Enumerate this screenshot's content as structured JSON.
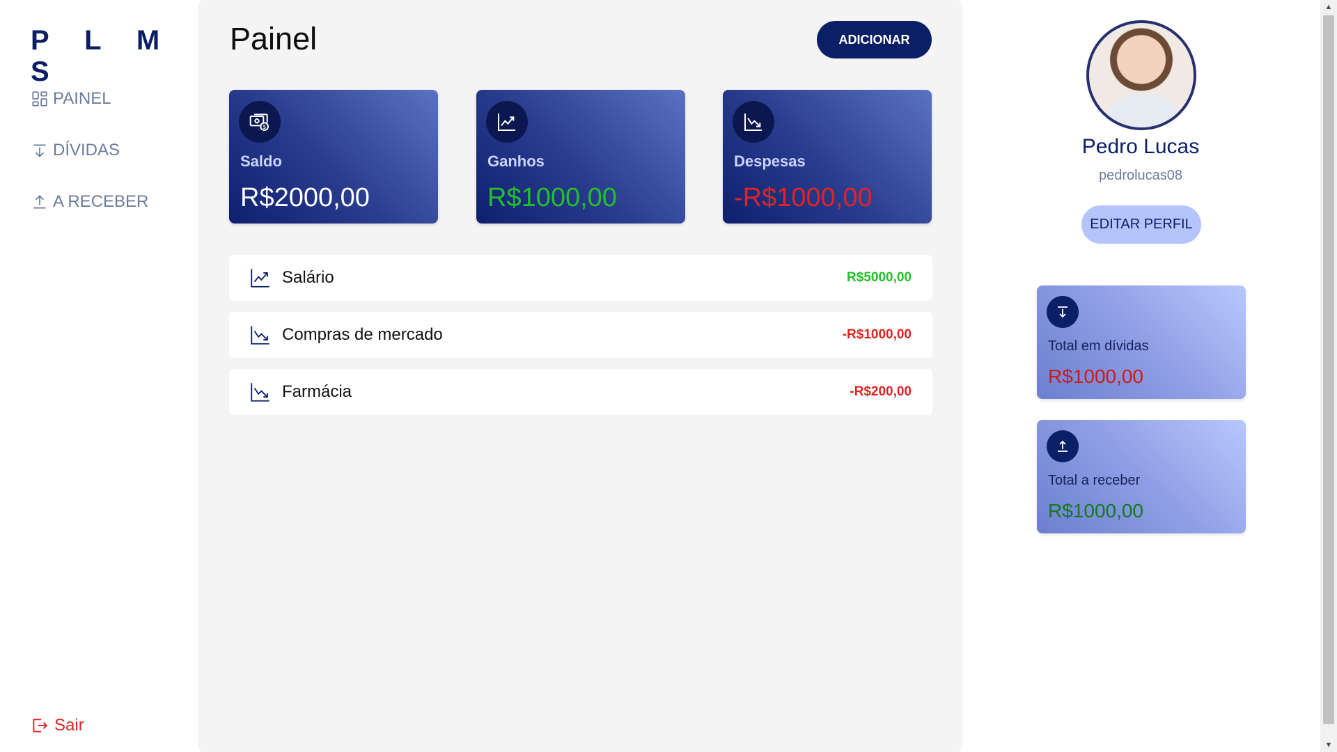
{
  "sidebar": {
    "logo": "P L M S",
    "items": [
      {
        "label": "PAINEL",
        "icon": "dashboard-grid-icon"
      },
      {
        "label": "DÍVIDAS",
        "icon": "arrow-down-icon"
      },
      {
        "label": "A RECEBER",
        "icon": "arrow-up-icon"
      }
    ],
    "logout_label": "Sair"
  },
  "main": {
    "title": "Painel",
    "add_button": "ADICIONAR",
    "cards": [
      {
        "label": "Saldo",
        "value": "R$2000,00",
        "icon": "money-icon",
        "value_color": "#ffffff"
      },
      {
        "label": "Ganhos",
        "value": "R$1000,00",
        "icon": "trending-up-icon",
        "value_color": "#22c02a"
      },
      {
        "label": "Despesas",
        "value": "-R$1000,00",
        "icon": "trending-down-icon",
        "value_color": "#e02424"
      }
    ],
    "transactions": [
      {
        "name": "Salário",
        "amount": "R$5000,00",
        "type": "income",
        "icon": "trending-up-icon",
        "color": "#22c02a"
      },
      {
        "name": "Compras de mercado",
        "amount": "-R$1000,00",
        "type": "expense",
        "icon": "trending-down-icon",
        "color": "#e02424"
      },
      {
        "name": "Farmácia",
        "amount": "-R$200,00",
        "type": "expense",
        "icon": "trending-down-icon",
        "color": "#e02424"
      }
    ]
  },
  "profile": {
    "name": "Pedro Lucas",
    "username": "pedrolucas08",
    "edit_button": "EDITAR PERFIL",
    "summary": [
      {
        "label": "Total em dívidas",
        "value": "R$1000,00",
        "icon": "arrow-down-icon",
        "value_color": "#d01818"
      },
      {
        "label": "Total a receber",
        "value": "R$1000,00",
        "icon": "arrow-up-icon",
        "value_color": "#117a1f"
      }
    ]
  },
  "colors": {
    "brand": "#0b1f66",
    "positive": "#22c02a",
    "negative": "#e02424",
    "nav_text": "#6b7c9c"
  }
}
